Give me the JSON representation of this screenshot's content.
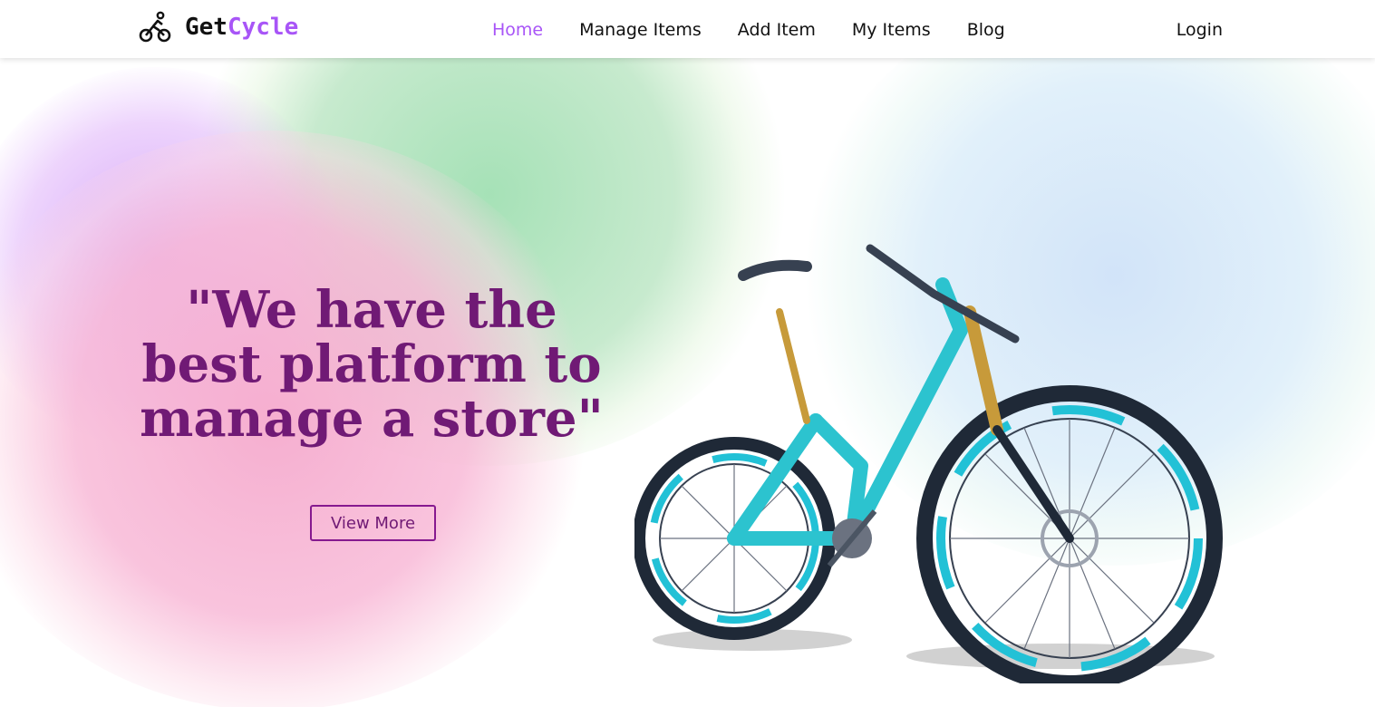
{
  "brand": {
    "prefix": "Get",
    "accent": "Cycle",
    "icon": "cyclist-icon",
    "accent_color": "#a855f7"
  },
  "nav": {
    "items": [
      {
        "label": "Home",
        "active": true
      },
      {
        "label": "Manage Items"
      },
      {
        "label": "Add Item"
      },
      {
        "label": "My Items"
      },
      {
        "label": "Blog"
      }
    ],
    "login": "Login"
  },
  "hero": {
    "headline_lines": [
      "\"We have the",
      "best platform to",
      "manage a store\""
    ],
    "button": "View More",
    "image": "mountain-bike-image",
    "headline_color": "#701a75"
  }
}
